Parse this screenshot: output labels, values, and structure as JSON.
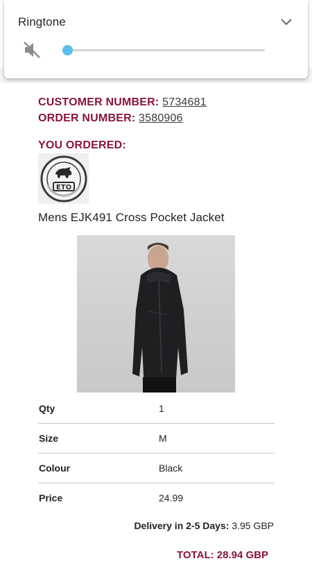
{
  "volume_panel": {
    "title": "Ringtone",
    "level": 0,
    "muted": true,
    "accent_color": "#5cbcea",
    "expand_icon": "chevron-down-icon",
    "mute_icon": "volume-mute-icon"
  },
  "order": {
    "customer_label": "CUSTOMER NUMBER:",
    "customer_number": "5734681",
    "order_label": "ORDER NUMBER:",
    "order_number": "3580906",
    "ordered_heading": "YOU ORDERED:",
    "brand_color": "#8a1538"
  },
  "brand_logo": {
    "text": "ETO",
    "ring_text": "ENGINEERED TO ORDER"
  },
  "product": {
    "name": "Mens EJK491 Cross Pocket Jacket",
    "details": [
      {
        "label": "Qty",
        "value": "1"
      },
      {
        "label": "Size",
        "value": "M"
      },
      {
        "label": "Colour",
        "value": "Black"
      },
      {
        "label": "Price",
        "value": "24.99"
      }
    ]
  },
  "delivery": {
    "label": "Delivery in 2-5 Days:",
    "value": "3.95 GBP"
  },
  "total": {
    "label": "TOTAL: 28.94 GBP"
  }
}
